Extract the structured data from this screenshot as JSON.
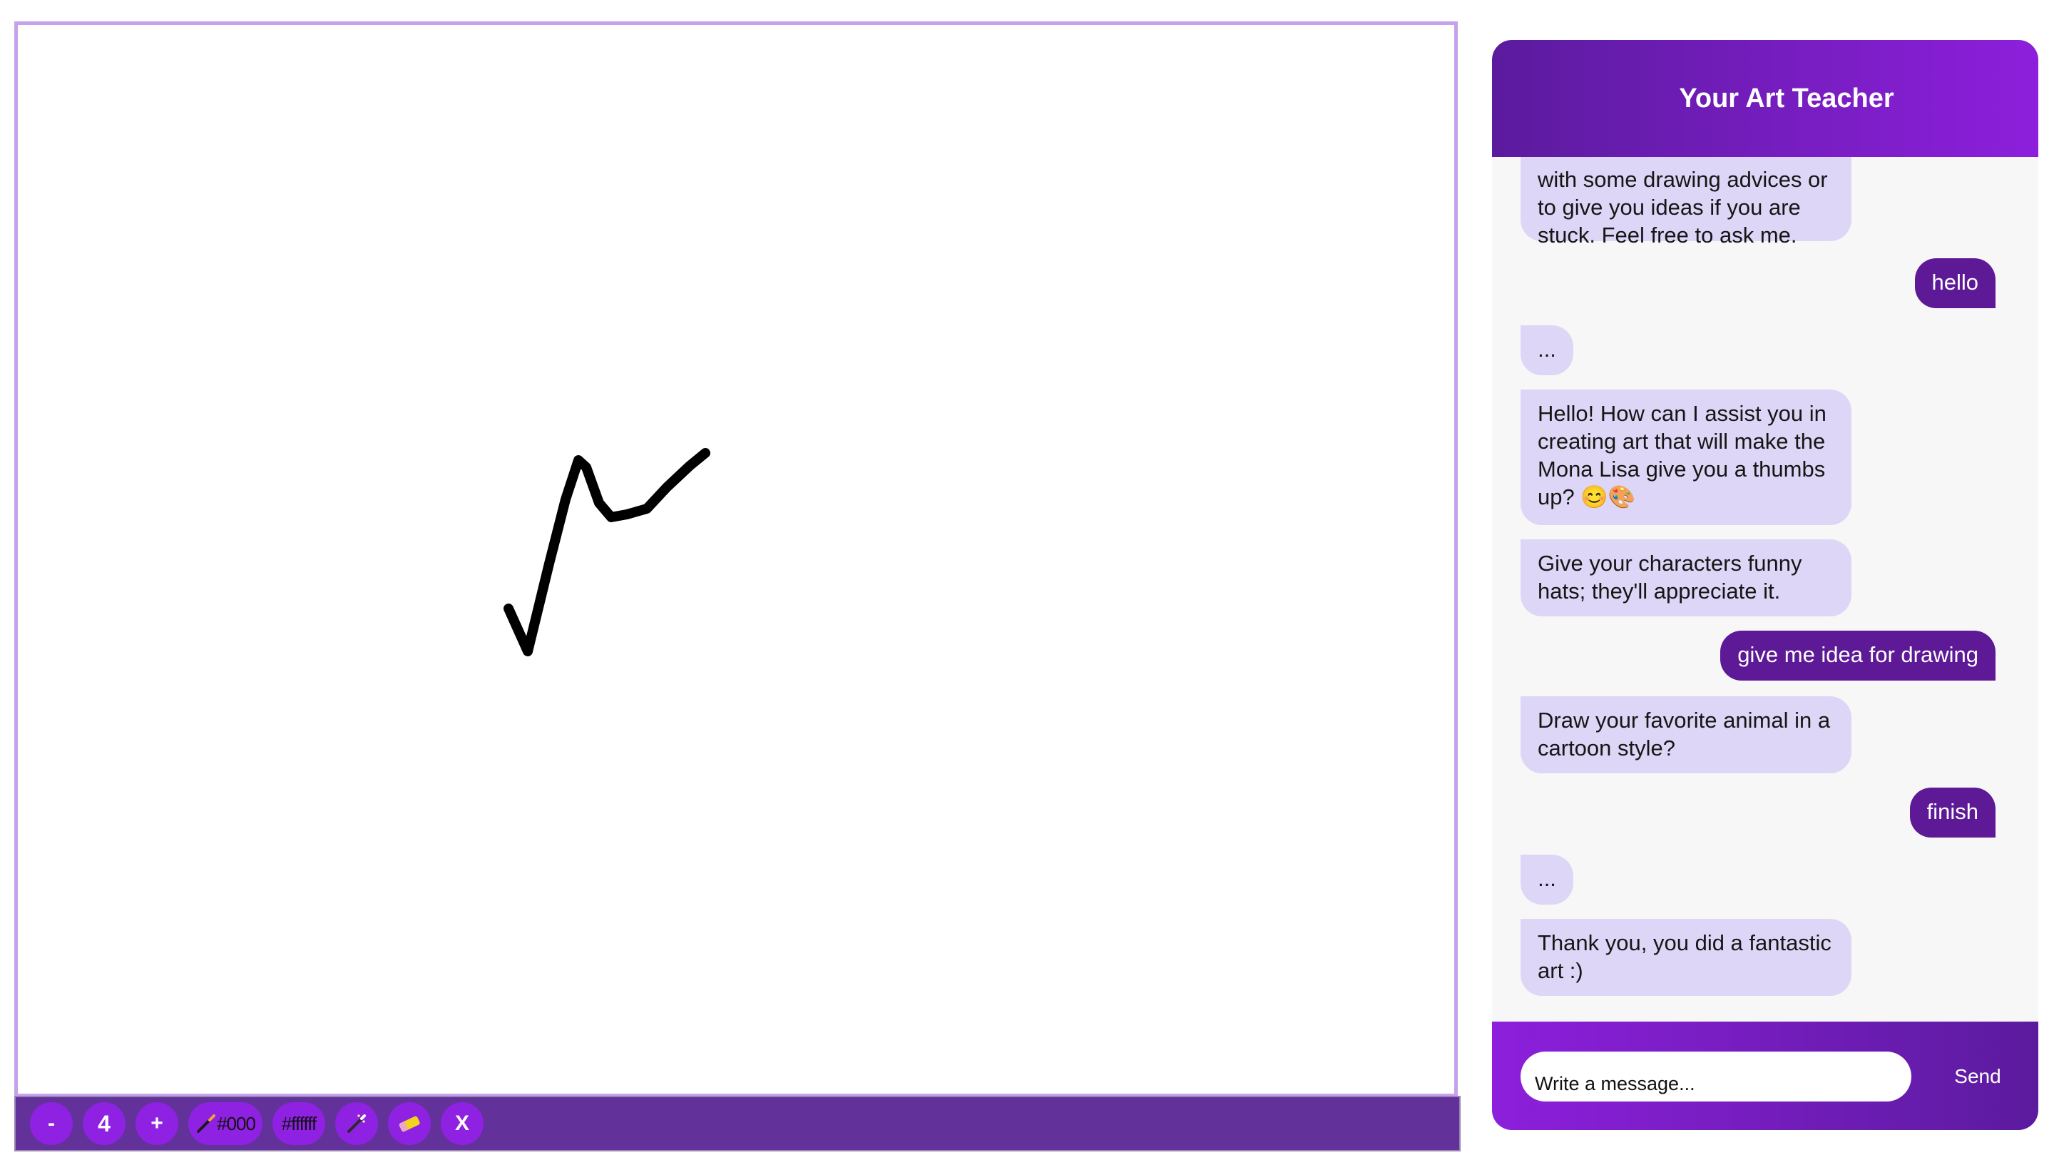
{
  "canvas": {
    "stroke_color": "#000000"
  },
  "toolbar": {
    "decrease_label": "-",
    "size_value": "4",
    "increase_label": "+",
    "pen_color_label": "#000",
    "bg_color_label": "#ffffff",
    "button_color": "#8f22e2",
    "bar_color": "#63319a",
    "clear_label": "X"
  },
  "chat": {
    "title": "Your Art Teacher",
    "messages": [
      {
        "role": "bot",
        "text": "with some drawing advices or to give you ideas if you are stuck. Feel free to ask me."
      },
      {
        "role": "user",
        "text": "hello"
      },
      {
        "role": "bot",
        "text": "..."
      },
      {
        "role": "bot",
        "text": "Hello! How can I assist you in creating art that will make the Mona Lisa give you a thumbs up? 😊🎨"
      },
      {
        "role": "bot",
        "text": "Give your characters funny hats; they'll appreciate it."
      },
      {
        "role": "user",
        "text": "give me idea for drawing"
      },
      {
        "role": "bot",
        "text": "Draw your favorite animal in a cartoon style?"
      },
      {
        "role": "user",
        "text": "finish"
      },
      {
        "role": "bot",
        "text": "..."
      },
      {
        "role": "bot",
        "text": "Thank you, you did a fantastic art :)"
      }
    ],
    "input_placeholder": "Write a message...",
    "send_label": "Send",
    "accent_dark": "#5b1b9e",
    "accent_light": "#8d1fdc",
    "bot_bubble": "#ddd6f6"
  }
}
